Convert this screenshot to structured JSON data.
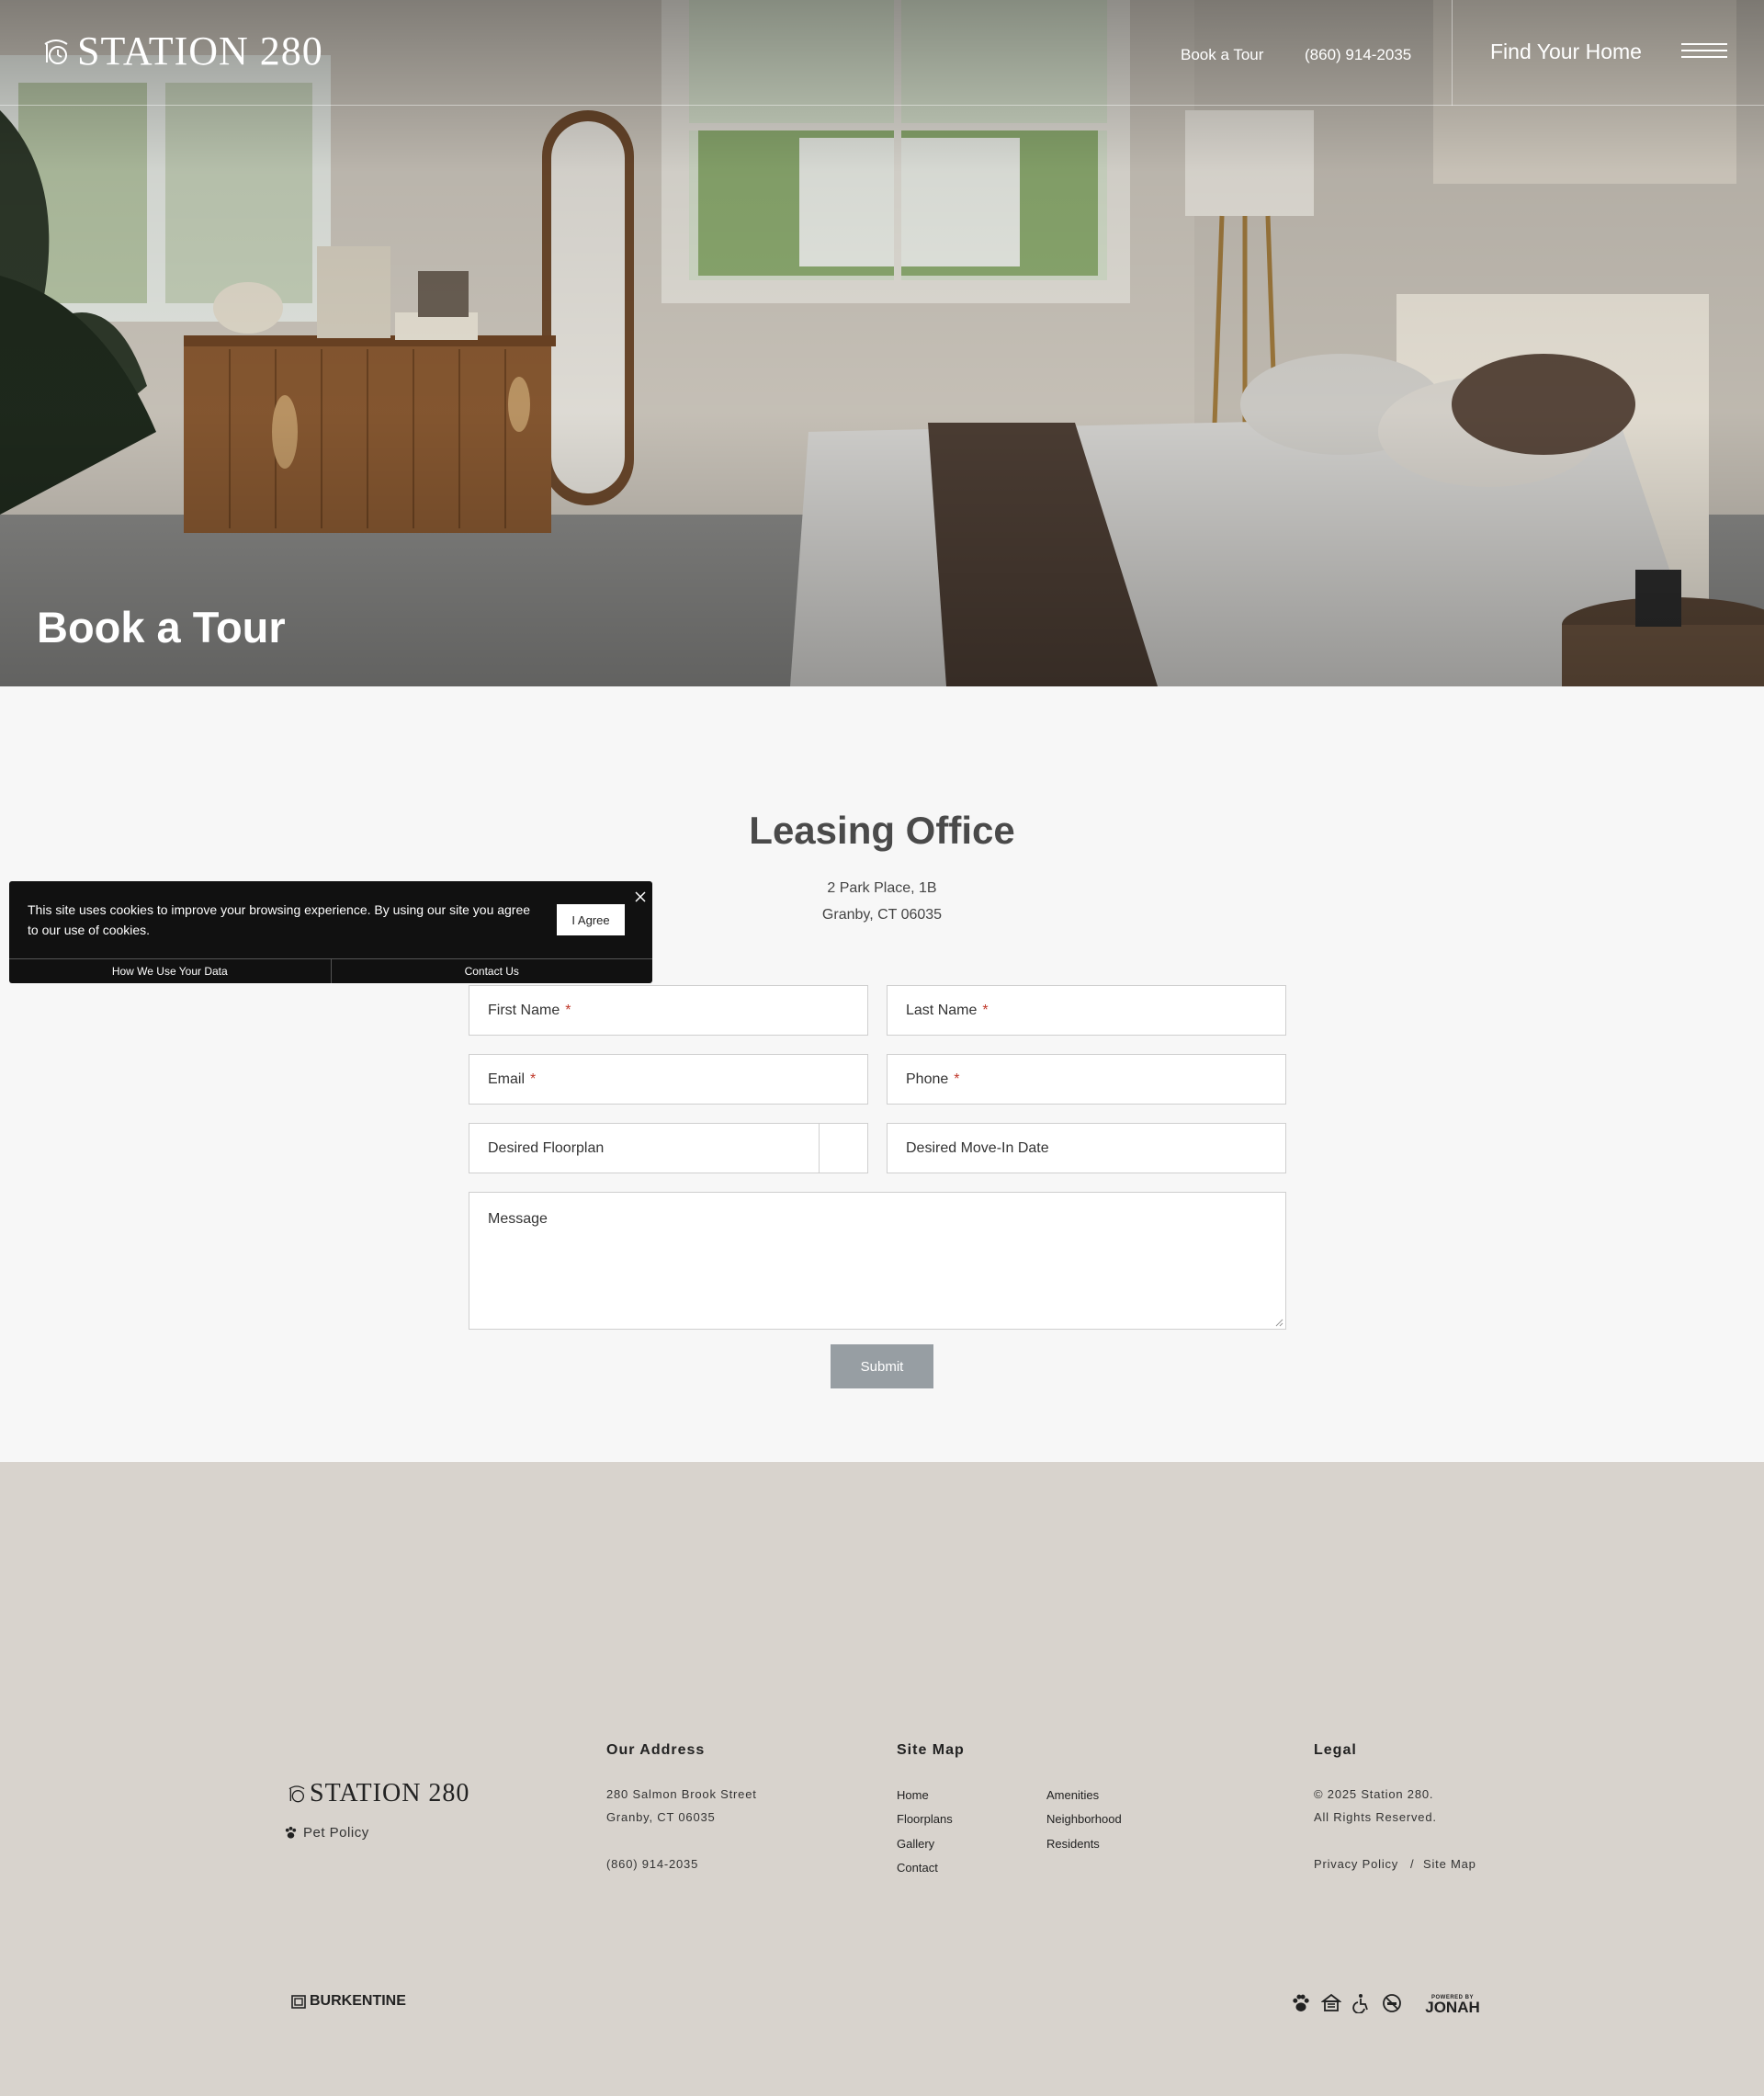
{
  "header": {
    "logo_text": "STATION 280",
    "nav_book": "Book a Tour",
    "nav_phone": "(860) 914-2035",
    "nav_find": "Find Your Home"
  },
  "hero": {
    "title": "Book a Tour"
  },
  "leasing": {
    "title": "Leasing Office",
    "address_line1": "2 Park Place, 1B",
    "address_line2": "Granby, CT 06035"
  },
  "form": {
    "first_name": "First Name",
    "last_name": "Last Name",
    "email": "Email",
    "phone": "Phone",
    "floorplan": "Desired Floorplan",
    "move_in": "Desired Move-In Date",
    "message": "Message",
    "required_mark": "*",
    "submit": "Submit"
  },
  "cookie": {
    "text": "This site uses cookies to improve your browsing experience. By using our site you agree to our use of cookies.",
    "agree": "I Agree",
    "link_data": "How We Use Your Data",
    "link_contact": "Contact Us"
  },
  "footer": {
    "logo_text": "STATION 280",
    "pet_policy": "Pet Policy",
    "address_heading": "Our Address",
    "address_line1": "280 Salmon Brook Street",
    "address_line2": "Granby, CT 06035",
    "phone": "(860) 914-2035",
    "sitemap_heading": "Site Map",
    "sitemap_col1": [
      "Home",
      "Floorplans",
      "Gallery",
      "Contact"
    ],
    "sitemap_col2": [
      "Amenities",
      "Neighborhood",
      "Residents"
    ],
    "legal_heading": "Legal",
    "copyright": "© 2025 Station 280.",
    "rights": "All Rights Reserved.",
    "privacy": "Privacy Policy",
    "separator": "/",
    "sitemap_link": "Site Map",
    "brand": "BURKENTINE",
    "powered_by": "POWERED BY",
    "jonah": "JONAH",
    "icons": [
      "pet-friendly-icon",
      "equal-housing-icon",
      "accessibility-icon",
      "no-smoking-icon"
    ]
  }
}
